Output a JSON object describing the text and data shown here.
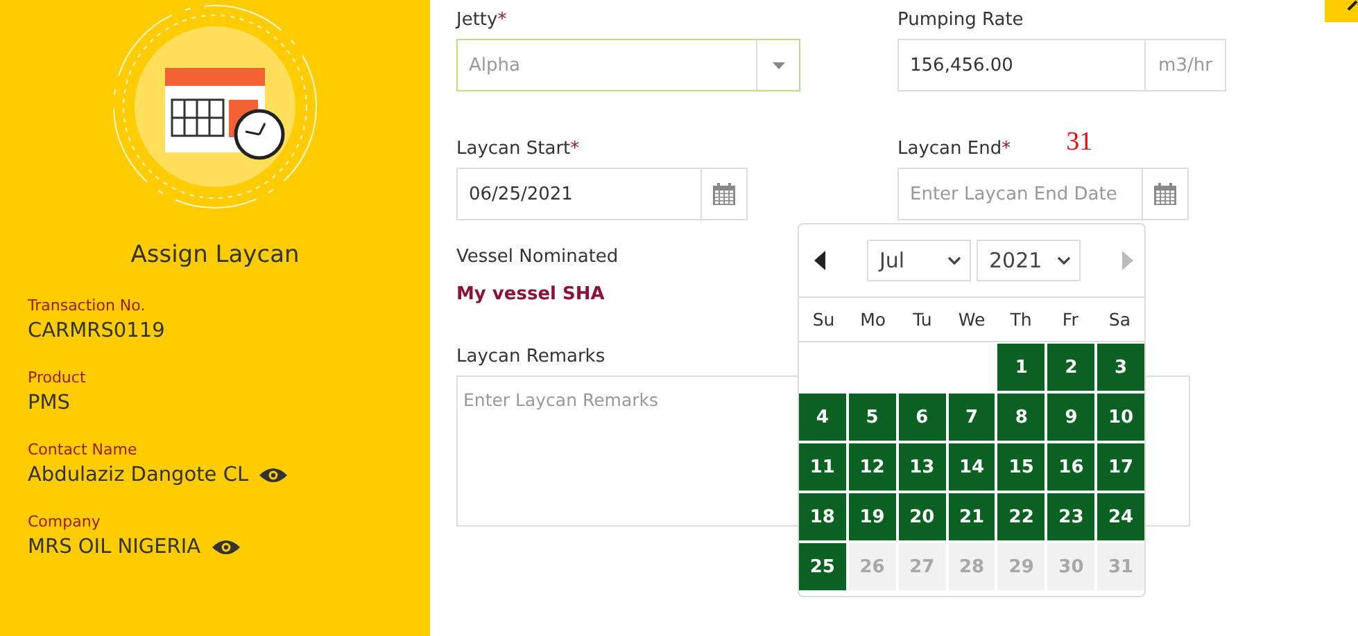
{
  "sidebar": {
    "title": "Assign Laycan",
    "details": [
      {
        "label": "Transaction No.",
        "value": "CARMRS0119",
        "has_view": false
      },
      {
        "label": "Product",
        "value": "PMS",
        "has_view": false
      },
      {
        "label": "Contact Name",
        "value": "Abdulaziz Dangote CL",
        "has_view": true
      },
      {
        "label": "Company",
        "value": "MRS OIL NIGERIA",
        "has_view": true
      }
    ]
  },
  "form": {
    "jetty": {
      "label": "Jetty",
      "required_mark": "*",
      "placeholder": "Alpha"
    },
    "pumping_rate": {
      "label": "Pumping Rate",
      "value": "156,456.00",
      "unit": "m3/hr"
    },
    "laycan_start": {
      "label": "Laycan Start",
      "required_mark": "*",
      "value": "06/25/2021"
    },
    "laycan_end": {
      "label": "Laycan End",
      "required_mark": "*",
      "placeholder": "Enter Laycan End Date",
      "annotation": "31"
    },
    "vessel": {
      "label": "Vessel Nominated",
      "value": "My vessel SHA"
    },
    "remarks": {
      "label": "Laycan Remarks",
      "placeholder": "Enter Laycan Remarks"
    }
  },
  "datepicker": {
    "month": "Jul",
    "year": "2021",
    "prev_disabled": false,
    "next_disabled": true,
    "weekdays": [
      "Su",
      "Mo",
      "Tu",
      "We",
      "Th",
      "Fr",
      "Sa"
    ],
    "days": [
      {
        "kind": "blank"
      },
      {
        "kind": "blank"
      },
      {
        "kind": "blank"
      },
      {
        "kind": "blank"
      },
      {
        "kind": "day",
        "label": "1",
        "disabled": false
      },
      {
        "kind": "day",
        "label": "2",
        "disabled": false
      },
      {
        "kind": "day",
        "label": "3",
        "disabled": false
      },
      {
        "kind": "day",
        "label": "4",
        "disabled": false
      },
      {
        "kind": "day",
        "label": "5",
        "disabled": false
      },
      {
        "kind": "day",
        "label": "6",
        "disabled": false
      },
      {
        "kind": "day",
        "label": "7",
        "disabled": false
      },
      {
        "kind": "day",
        "label": "8",
        "disabled": false
      },
      {
        "kind": "day",
        "label": "9",
        "disabled": false
      },
      {
        "kind": "day",
        "label": "10",
        "disabled": false
      },
      {
        "kind": "day",
        "label": "11",
        "disabled": false
      },
      {
        "kind": "day",
        "label": "12",
        "disabled": false
      },
      {
        "kind": "day",
        "label": "13",
        "disabled": false
      },
      {
        "kind": "day",
        "label": "14",
        "disabled": false
      },
      {
        "kind": "day",
        "label": "15",
        "disabled": false
      },
      {
        "kind": "day",
        "label": "16",
        "disabled": false
      },
      {
        "kind": "day",
        "label": "17",
        "disabled": false
      },
      {
        "kind": "day",
        "label": "18",
        "disabled": false
      },
      {
        "kind": "day",
        "label": "19",
        "disabled": false
      },
      {
        "kind": "day",
        "label": "20",
        "disabled": false
      },
      {
        "kind": "day",
        "label": "21",
        "disabled": false
      },
      {
        "kind": "day",
        "label": "22",
        "disabled": false
      },
      {
        "kind": "day",
        "label": "23",
        "disabled": false
      },
      {
        "kind": "day",
        "label": "24",
        "disabled": false
      },
      {
        "kind": "day",
        "label": "25",
        "disabled": false
      },
      {
        "kind": "day",
        "label": "26",
        "disabled": true
      },
      {
        "kind": "day",
        "label": "27",
        "disabled": true
      },
      {
        "kind": "day",
        "label": "28",
        "disabled": true
      },
      {
        "kind": "day",
        "label": "29",
        "disabled": true
      },
      {
        "kind": "day",
        "label": "30",
        "disabled": true
      },
      {
        "kind": "day",
        "label": "31",
        "disabled": true
      }
    ]
  }
}
